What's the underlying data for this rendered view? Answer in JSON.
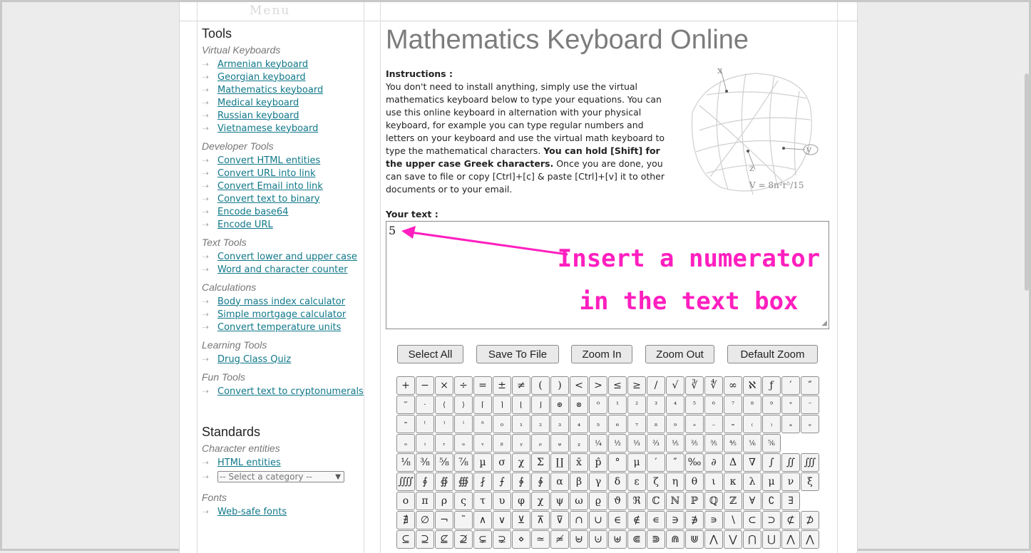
{
  "menu_label": "Menu",
  "sidebar": {
    "tools_heading": "Tools",
    "standards_heading": "Standards",
    "groups": [
      {
        "title": "Virtual Keyboards",
        "links": [
          "Armenian keyboard",
          "Georgian keyboard",
          "Mathematics keyboard",
          "Medical keyboard",
          "Russian keyboard",
          "Vietnamese keyboard"
        ]
      },
      {
        "title": "Developer Tools",
        "links": [
          "Convert HTML entities",
          "Convert URL into link",
          "Convert Email into link",
          "Convert text to binary",
          "Encode base64",
          "Encode URL"
        ]
      },
      {
        "title": "Text Tools",
        "links": [
          "Convert lower and upper case",
          "Word and character counter"
        ]
      },
      {
        "title": "Calculations",
        "links": [
          "Body mass index calculator",
          "Simple mortgage calculator",
          "Convert temperature units"
        ]
      },
      {
        "title": "Learning Tools",
        "links": [
          "Drug Class Quiz"
        ]
      },
      {
        "title": "Fun Tools",
        "links": [
          "Convert text to cryptonumerals"
        ]
      }
    ],
    "character_entities": {
      "title": "Character entities",
      "link": "HTML entities",
      "select_value": "-- Select a category --"
    },
    "fonts": {
      "title": "Fonts",
      "link": "Web-safe fonts"
    }
  },
  "main": {
    "title": "Mathematics Keyboard Online",
    "instructions_label": "Instructions :",
    "instructions_text_1": "You don't need to install anything, simply use the virtual mathematics keyboard below to type your equations. You can use this online keyboard in alternation with your physical keyboard, for example you can type regular numbers and letters on your keyboard and use the virtual math keyboard to type the mathematical characters. ",
    "instructions_bold": "You can hold [Shift] for the upper case Greek characters.",
    "instructions_text_2": " Once you are done, you can save to file or copy [Ctrl]+[c] & paste [Ctrl]+[v] it to other documents or to your email.",
    "figure_formula": "V = 8π²r⁵/15",
    "your_text_label": "Your text :",
    "text_value": "5",
    "annotation_line1": "Insert a numerator",
    "annotation_line2": "in the text box",
    "buttons": [
      "Select All",
      "Save To File",
      "Zoom In",
      "Zoom Out",
      "Default Zoom"
    ]
  },
  "keyboard_rows": [
    [
      "+",
      "−",
      "×",
      "÷",
      "=",
      "±",
      "≠",
      "(",
      ")",
      "<",
      ">",
      "≤",
      "≥",
      "/",
      "√",
      "∛",
      "∜",
      "∞",
      "ℵ",
      "ƒ",
      "′",
      "″"
    ],
    [
      "‴",
      "·",
      "⟨",
      "⟩",
      "⌈",
      "⌉",
      "⌊",
      "⌋",
      "⊕",
      "⊗",
      "⁰",
      "¹",
      "²",
      "³",
      "⁴",
      "⁵",
      "⁶",
      "⁷",
      "⁸",
      "⁹",
      "⁺",
      "⁻"
    ],
    [
      "⁼",
      "⁽",
      "⁾",
      "ⁱ",
      "ⁿ",
      "₀",
      "₁",
      "₂",
      "₃",
      "₄",
      "₅",
      "₆",
      "₇",
      "₈",
      "₉",
      "₊",
      "₋",
      "₌",
      "₍",
      "₎",
      "ₐ",
      "ₑ"
    ],
    [
      "ₒ",
      "ᵢ",
      "ᵣ",
      "ᵤ",
      "ᵥ",
      "ᵦ",
      "ᵧ",
      "ᵨ",
      "ᵩ",
      "ᵪ",
      "¼",
      "½",
      "⅓",
      "⅔",
      "⅕",
      "⅖",
      "⅗",
      "⅘",
      "⅙",
      "⅚"
    ],
    [
      "⅛",
      "⅜",
      "⅝",
      "⅞",
      "µ",
      "σ",
      "χ",
      "Σ",
      "∐",
      "x̄",
      "p̂",
      "°",
      "μ",
      "′",
      "″",
      "‰",
      "∂",
      "Δ",
      "∇",
      "∫",
      "∬",
      "∭"
    ],
    [
      "⨌",
      "∮",
      "∯",
      "∰",
      "⨏",
      "⨍",
      "∲",
      "∳",
      "α",
      "β",
      "γ",
      "δ",
      "ε",
      "ζ",
      "η",
      "θ",
      "ι",
      "κ",
      "λ",
      "μ",
      "ν",
      "ξ"
    ],
    [
      "ο",
      "π",
      "ρ",
      "ς",
      "τ",
      "υ",
      "φ",
      "χ",
      "ψ",
      "ω",
      "ϱ",
      "ϑ",
      "ℜ",
      "ℂ",
      "ℕ",
      "ℙ",
      "ℚ",
      "ℤ",
      "∀",
      "∁",
      "∃"
    ],
    [
      "∄",
      "∅",
      "¬",
      "˜",
      "∧",
      "∨",
      "⊻",
      "⊼",
      "⊽",
      "∩",
      "∪",
      "∈",
      "∉",
      "∊",
      "∋",
      "∌",
      "∍",
      "∖",
      "⊂",
      "⊃",
      "⊄",
      "⊅"
    ],
    [
      "⊆",
      "⊇",
      "⊈",
      "⊉",
      "⊊",
      "⊋",
      "⋄",
      "≃",
      "≄",
      "⊌",
      "⊍",
      "⊎",
      "⋐",
      "⋑",
      "⋒",
      "⋓",
      "⋀",
      "⋁",
      "⋂",
      "⋃",
      "⋀",
      "⋀"
    ]
  ]
}
